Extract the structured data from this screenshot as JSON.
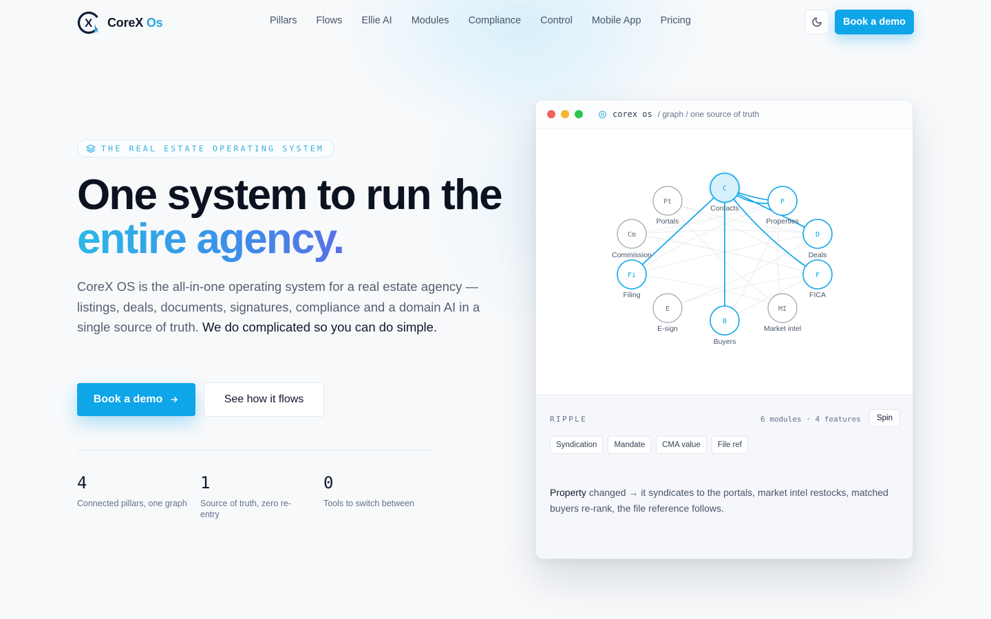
{
  "brand": {
    "name_part1": "CoreX",
    "name_part2": "Os",
    "logo_letters": "X"
  },
  "nav": {
    "links": [
      "Pillars",
      "Flows",
      "Ellie AI",
      "Modules",
      "Compliance",
      "Control",
      "Mobile App",
      "Pricing"
    ],
    "theme_icon": "moon-icon",
    "cta": "Book a demo"
  },
  "hero": {
    "eyebrow": "THE REAL ESTATE OPERATING SYSTEM",
    "eyebrow_icon": "layers-icon",
    "title_line1": "One system to run the",
    "title_line2": "entire agency.",
    "desc_plain": "CoreX OS is the all-in-one operating system for a real estate agency — listings, deals, documents, signatures, compliance and a domain AI in a single source of truth.",
    "desc_strong": " We do complicated so you can do simple.",
    "cta_primary": "Book a demo",
    "cta_primary_icon": "arrow-right-icon",
    "cta_secondary": "See how it flows",
    "stats": [
      {
        "num": "4",
        "label": "Connected pillars, one graph"
      },
      {
        "num": "1",
        "label": "Source of truth, zero re-entry"
      },
      {
        "num": "0",
        "label": "Tools to switch between"
      }
    ]
  },
  "window": {
    "path_app": "corex os",
    "path_rest": "/ graph / one source of truth",
    "path_icon": "target-icon",
    "colors": {
      "close": "#f0625d",
      "minimize": "#f5b62e",
      "maximize": "#2ec74d",
      "accent": "#0ea5e9"
    },
    "graph": {
      "nodes": [
        {
          "id": "C",
          "label": "Contacts",
          "active": true,
          "focus": true
        },
        {
          "id": "P",
          "label": "Properties",
          "active": true
        },
        {
          "id": "D",
          "label": "Deals",
          "active": true
        },
        {
          "id": "F",
          "label": "FICA",
          "active": true
        },
        {
          "id": "MI",
          "label": "Market intel",
          "active": false
        },
        {
          "id": "B",
          "label": "Buyers",
          "active": true
        },
        {
          "id": "E",
          "label": "E-sign",
          "active": false
        },
        {
          "id": "Fi",
          "label": "Filing",
          "active": true
        },
        {
          "id": "Cm",
          "label": "Commission",
          "active": false
        },
        {
          "id": "Pt",
          "label": "Portals",
          "active": false
        }
      ],
      "active_edges": [
        [
          "C",
          "P"
        ],
        [
          "C",
          "D"
        ],
        [
          "C",
          "F"
        ],
        [
          "C",
          "B"
        ],
        [
          "C",
          "Fi"
        ],
        [
          "C",
          "P"
        ]
      ]
    },
    "ripple": {
      "label": "RIPPLE",
      "meta": "6 modules · 4 features",
      "spin": "Spin",
      "chips": [
        "Syndication",
        "Mandate",
        "CMA value",
        "File ref"
      ],
      "text_strong": "Property",
      "text_rest": " changed → it syndicates to the portals, market intel restocks, matched buyers re-rank, the file reference follows."
    }
  }
}
